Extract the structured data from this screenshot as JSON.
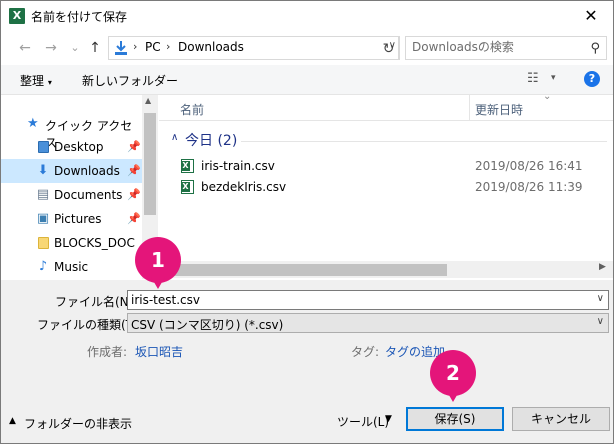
{
  "window": {
    "title": "名前を付けて保存",
    "close_glyph": "✕"
  },
  "nav": {
    "back_glyph": "←",
    "forward_glyph": "→",
    "recent_glyph": "⌄",
    "up_glyph": "↑",
    "path": [
      "PC",
      "Downloads"
    ],
    "search_placeholder": "Downloadsの検索"
  },
  "toolbar": {
    "organize_label": "整理",
    "new_folder_label": "新しいフォルダー"
  },
  "sidebar": {
    "quick_access_label": "クイック アクセス",
    "items": [
      {
        "label": "Desktop",
        "icon": "folder-blue-icon",
        "pinned": true,
        "selected": false
      },
      {
        "label": "Downloads",
        "icon": "download-icon",
        "pinned": true,
        "selected": true
      },
      {
        "label": "Documents",
        "icon": "documents-icon",
        "pinned": true,
        "selected": false
      },
      {
        "label": "Pictures",
        "icon": "pictures-icon",
        "pinned": true,
        "selected": false
      },
      {
        "label": "BLOCKS_DOC",
        "icon": "folder-icon",
        "pinned": false,
        "selected": false
      },
      {
        "label": "Music",
        "icon": "music-icon",
        "pinned": false,
        "selected": false
      }
    ]
  },
  "filelist": {
    "columns": {
      "name": "名前",
      "date": "更新日時"
    },
    "group_label": "今日 (2)",
    "files": [
      {
        "name": "iris-train.csv",
        "date": "2019/08/26 16:41"
      },
      {
        "name": "bezdekIris.csv",
        "date": "2019/08/26 11:39"
      }
    ]
  },
  "form": {
    "filename_label": "ファイル名(N):",
    "filename_value": "iris-test.csv",
    "filetype_label": "ファイルの種類(T):",
    "filetype_value": "CSV (コンマ区切り) (*.csv)",
    "author_label": "作成者:",
    "author_value": "坂口昭吉",
    "tags_label": "タグ:",
    "tags_value": "タグの追加",
    "hide_folders_label": "フォルダーの非表示",
    "tools_label": "ツール(L)",
    "save_label": "保存(S)",
    "cancel_label": "キャンセル"
  },
  "callouts": [
    "1",
    "2"
  ],
  "colors": {
    "accent": "#0078d7",
    "badge": "#e4157a",
    "selected_bg": "#cce8ff"
  }
}
